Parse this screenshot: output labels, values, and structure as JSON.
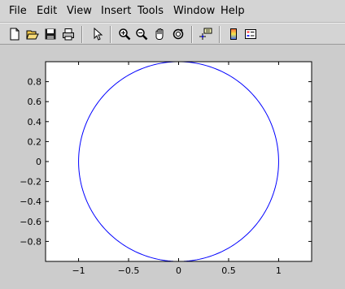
{
  "menu": {
    "file": "File",
    "edit": "Edit",
    "view": "View",
    "insert": "Insert",
    "tools": "Tools",
    "window": "Window",
    "help": "Help"
  },
  "toolbar": {
    "icons": [
      "new-file-icon",
      "open-folder-icon",
      "save-icon",
      "print-icon",
      "pointer-arrow-icon",
      "zoom-in-icon",
      "zoom-out-icon",
      "pan-hand-icon",
      "rotate-3d-icon",
      "data-cursor-icon",
      "colorbar-icon",
      "legend-icon"
    ]
  },
  "colors": {
    "window_bg": "#cccccc",
    "axes_bg": "#ffffff",
    "line": "#0000ff"
  },
  "chart_data": {
    "type": "line",
    "title": "",
    "xlabel": "",
    "ylabel": "",
    "xlim": [
      -1.33,
      1.33
    ],
    "ylim": [
      -1,
      1
    ],
    "xticks": [
      -1,
      -0.5,
      0,
      0.5,
      1
    ],
    "xtick_labels": [
      "−1",
      "−0.5",
      "0",
      "0.5",
      "1"
    ],
    "yticks": [
      -0.8,
      -0.6,
      -0.4,
      -0.2,
      0,
      0.2,
      0.4,
      0.6,
      0.8
    ],
    "ytick_labels": [
      "−0.8",
      "−0.6",
      "−0.4",
      "−0.2",
      "0",
      "0.2",
      "0.4",
      "0.6",
      "0.8"
    ],
    "grid": false,
    "series": [
      {
        "color": "#0000ff",
        "shape": "unit circle x = cos(t), y = sin(t)",
        "x": [
          1,
          0.924,
          0.707,
          0.383,
          0,
          -0.383,
          -0.707,
          -0.924,
          -1,
          -0.924,
          -0.707,
          -0.383,
          0,
          0.383,
          0.707,
          0.924,
          1
        ],
        "y": [
          0,
          0.383,
          0.707,
          0.924,
          1,
          0.924,
          0.707,
          0.383,
          0,
          -0.383,
          -0.707,
          -0.924,
          -1,
          -0.924,
          -0.707,
          -0.383,
          0
        ]
      }
    ]
  }
}
